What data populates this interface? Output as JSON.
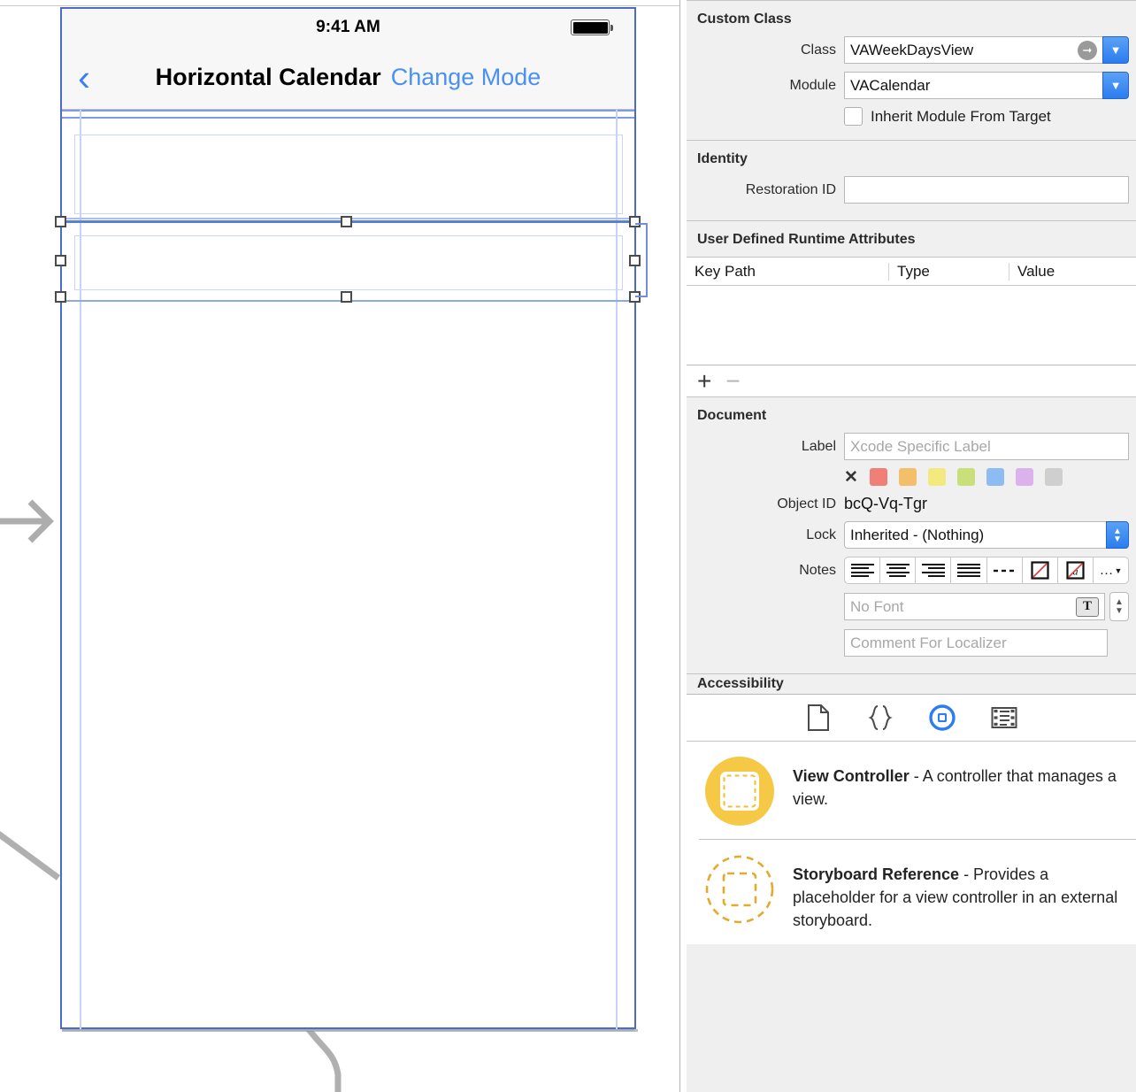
{
  "canvas": {
    "device": {
      "status_bar": {
        "time": "9:41 AM",
        "battery_icon": "battery-icon"
      },
      "nav_bar": {
        "back_icon": "chevron-left-icon",
        "title": "Horizontal Calendar",
        "action_label": "Change Mode"
      }
    },
    "entry_arrow_icon": "entry-point-arrow-icon",
    "segue_icon": "segue-connector-icon"
  },
  "inspector": {
    "custom_class": {
      "title": "Custom Class",
      "class_label": "Class",
      "class_value": "VAWeekDaysView",
      "class_jump_icon": "jump-to-definition-icon",
      "module_label": "Module",
      "module_value": "VACalendar",
      "inherit_label": "Inherit Module From Target",
      "inherit_checked": false,
      "dropdown_icon": "chevron-down-icon"
    },
    "identity": {
      "title": "Identity",
      "restoration_label": "Restoration ID",
      "restoration_value": ""
    },
    "runtime_attributes": {
      "title": "User Defined Runtime Attributes",
      "columns": [
        "Key Path",
        "Type",
        "Value"
      ],
      "rows": [],
      "add_label": "+",
      "remove_label": "−"
    },
    "document": {
      "title": "Document",
      "label_label": "Label",
      "label_placeholder": "Xcode Specific Label",
      "label_value": "",
      "swatch_clear_icon": "clear-color-icon",
      "swatches": [
        "#ef7f77",
        "#f4bf6b",
        "#f2ea7e",
        "#c9e07a",
        "#8cbdf2",
        "#dbb2ec",
        "#cfcfcf"
      ],
      "object_id_label": "Object ID",
      "object_id_value": "bcQ-Vq-Tgr",
      "lock_label": "Lock",
      "lock_value": "Inherited - (Nothing)",
      "notes_label": "Notes",
      "notes_buttons": [
        "align-left-icon",
        "align-center-icon",
        "align-right-icon",
        "align-justify-icon",
        "dashes-icon",
        "no-color-icon",
        "no-font-color-icon",
        "more-options-icon"
      ],
      "more_label": "…",
      "font_placeholder": "No Font",
      "font_value": "",
      "font_picker_icon": "font-panel-icon",
      "comment_placeholder": "Comment For Localizer",
      "comment_value": ""
    },
    "accessibility": {
      "title": "Accessibility"
    }
  },
  "library": {
    "tabs": [
      {
        "name": "file-template-library-tab",
        "icon": "file-icon",
        "selected": false
      },
      {
        "name": "code-snippet-library-tab",
        "icon": "braces-icon",
        "selected": false
      },
      {
        "name": "object-library-tab",
        "icon": "object-circle-icon",
        "selected": true
      },
      {
        "name": "media-library-tab",
        "icon": "media-filmstrip-icon",
        "selected": false
      }
    ],
    "items": [
      {
        "icon": "view-controller-icon",
        "title": "View Controller",
        "description": " - A controller that manages a view."
      },
      {
        "icon": "storyboard-reference-icon",
        "title": "Storyboard Reference",
        "description": " - Provides a placeholder for a view controller in an external storyboard."
      }
    ]
  },
  "colors": {
    "accent_blue": "#2b7df0",
    "selection_blue": "#5b7fd4",
    "guide_blue": "#7f9ae8",
    "ios_tint": "#4a90f0",
    "library_gold": "#f5c846"
  }
}
